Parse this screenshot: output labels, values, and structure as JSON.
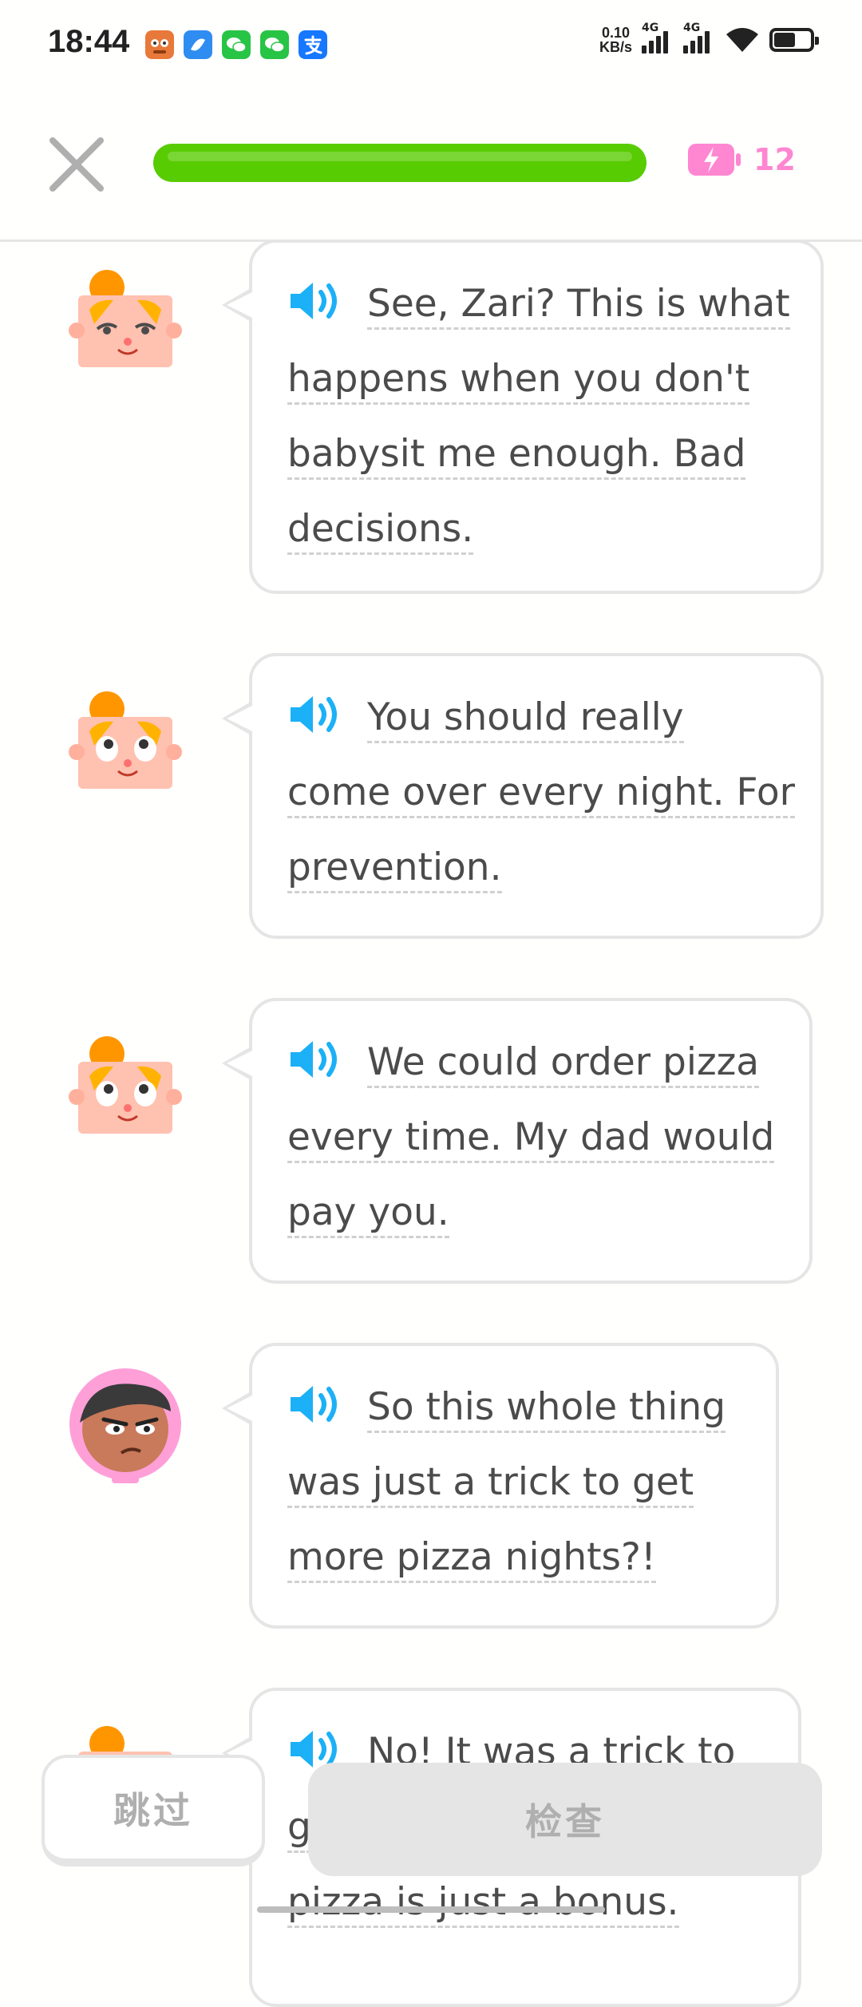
{
  "status_bar": {
    "time": "18:44",
    "net_speed_value": "0.10",
    "net_speed_unit": "KB/s",
    "signal_1_label": "4G",
    "signal_2_label": "4G"
  },
  "header": {
    "progress_percent": 100,
    "energy_count": "12"
  },
  "colors": {
    "progress_green": "#58cc02",
    "energy_pink": "#ff86d0",
    "speaker_blue": "#1cb0f6"
  },
  "dialogue": [
    {
      "speaker": "boy",
      "lines": [
        "See, Zari? This is what",
        "happens when you don't",
        "babysit me enough. Bad",
        "decisions."
      ]
    },
    {
      "speaker": "boy",
      "lines": [
        "You should really",
        "come over every night. For",
        "prevention."
      ]
    },
    {
      "speaker": "boy",
      "lines": [
        "We could order pizza",
        "every time. My dad would",
        "pay you."
      ]
    },
    {
      "speaker": "zari",
      "lines": [
        "So this whole thing",
        "was just a trick to get",
        "more pizza nights?!"
      ]
    },
    {
      "speaker": "boy",
      "lines": [
        "No! It was a trick to",
        "g",
        "pizza is just a bonus."
      ]
    }
  ],
  "buttons": {
    "skip_label": "跳过",
    "check_label": "检查"
  }
}
